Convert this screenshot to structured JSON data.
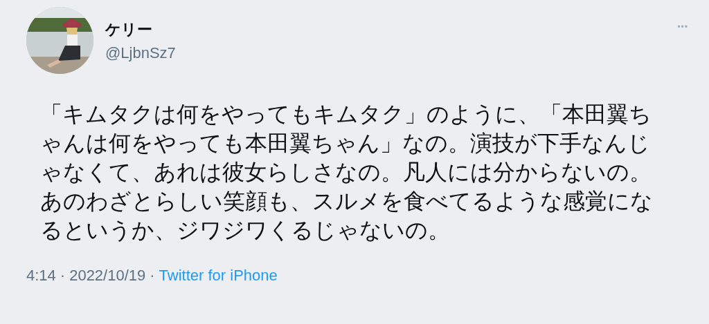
{
  "author": {
    "name": "ケリー",
    "handle": "@LjbnSz7"
  },
  "more_button": "•••",
  "text": "「キムタクは何をやってもキムタク」のように、「本田翼ちゃんは何をやっても本田翼ちゃん」なの。演技が下手なんじゃなくて、あれは彼女らしさなの。凡人には分からないの。あのわざとらしい笑顔も、スルメを食べてるような感覚になるというか、ジワジワくるじゃないの。",
  "meta": {
    "time": "4:14",
    "separator_1": "·",
    "date": "2022/10/19",
    "separator_2": "·",
    "source": "Twitter for iPhone"
  }
}
